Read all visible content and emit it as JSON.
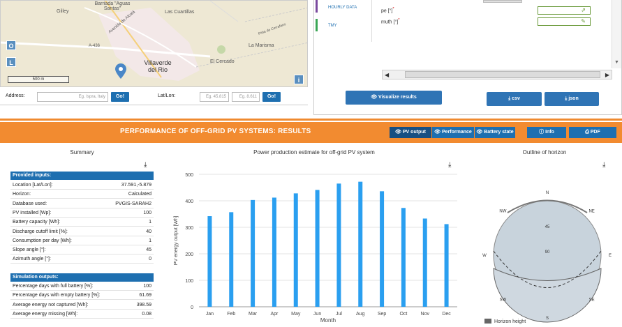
{
  "map": {
    "places": [
      "Gilley",
      "Barriada \"Aguas Santas\"",
      "Las Cuartillas",
      "Avenida de Alcalá",
      "A-436",
      "Villaverde del Rio",
      "El Cercado",
      "La Marisma",
      "Pista de Cerrafano"
    ],
    "scale": "500 m",
    "controls": [
      "O",
      "L",
      "i"
    ],
    "address_label": "Address:",
    "address_placeholder": "Eg. Ispra, Italy",
    "go": "Go!",
    "latlon_label": "Lat/Lon:",
    "lat_placeholder": "Eg. 45.815",
    "lon_placeholder": "Eg. 8.611"
  },
  "right_panel": {
    "tabs": [
      "HOURLY DATA",
      "TMY"
    ],
    "fields": [
      {
        "label": "pe [°]",
        "required": "*"
      },
      {
        "label": "muth [°]",
        "required": "*"
      }
    ],
    "visualize_label": "Visualize results",
    "csv_label": "csv",
    "json_label": "json"
  },
  "results": {
    "title": "PERFORMANCE OF OFF-GRID PV SYSTEMS: RESULTS",
    "buttons": [
      "PV output",
      "Performance",
      "Battery state",
      "Info",
      "PDF"
    ]
  },
  "summary": {
    "title": "Summary",
    "inputs_header": "Provided inputs:",
    "inputs": [
      {
        "k": "Location [Lat/Lon]:",
        "v": "37.591,-5.879"
      },
      {
        "k": "Horizon:",
        "v": "Calculated"
      },
      {
        "k": "Database used:",
        "v": "PVGIS-SARAH2"
      },
      {
        "k": "PV installed [Wp]:",
        "v": "100"
      },
      {
        "k": "Battery capacity [Wh]:",
        "v": "1"
      },
      {
        "k": "Discharge cutoff limit [%]:",
        "v": "40"
      },
      {
        "k": "Consumption per day [Wh]:",
        "v": "1"
      },
      {
        "k": "Slope angle [°]:",
        "v": "45"
      },
      {
        "k": "Azimuth angle [°]:",
        "v": "0"
      }
    ],
    "outputs_header": "Simulation outputs:",
    "outputs": [
      {
        "k": "Percentage days with full battery [%]:",
        "v": "100"
      },
      {
        "k": "Percentage days with empty battery [%]:",
        "v": "61.69"
      },
      {
        "k": "Average energy not captured [Wh]:",
        "v": "398.59"
      },
      {
        "k": "Average energy missing [Wh]:",
        "v": "0.08"
      }
    ]
  },
  "chart_data": {
    "type": "bar",
    "title": "Power production estimate for off-grid PV system",
    "xlabel": "Month",
    "ylabel": "PV energy output [Wh]",
    "categories": [
      "Jan",
      "Feb",
      "Mar",
      "Apr",
      "May",
      "Jun",
      "Jul",
      "Aug",
      "Sep",
      "Oct",
      "Nov",
      "Dec"
    ],
    "values": [
      342,
      357,
      403,
      412,
      428,
      441,
      465,
      472,
      436,
      373,
      333,
      312
    ],
    "ylim": [
      0,
      500
    ],
    "yticks": [
      0,
      100,
      200,
      300,
      400,
      500
    ],
    "color": "#2a9ff0"
  },
  "horizon": {
    "title": "Outline of horizon",
    "directions": [
      "N",
      "NE",
      "E",
      "SE",
      "S",
      "SW",
      "W",
      "NW"
    ],
    "rings": [
      "45",
      "90"
    ],
    "legend": "Horizon height",
    "sky_color": "#c8d3dc"
  }
}
